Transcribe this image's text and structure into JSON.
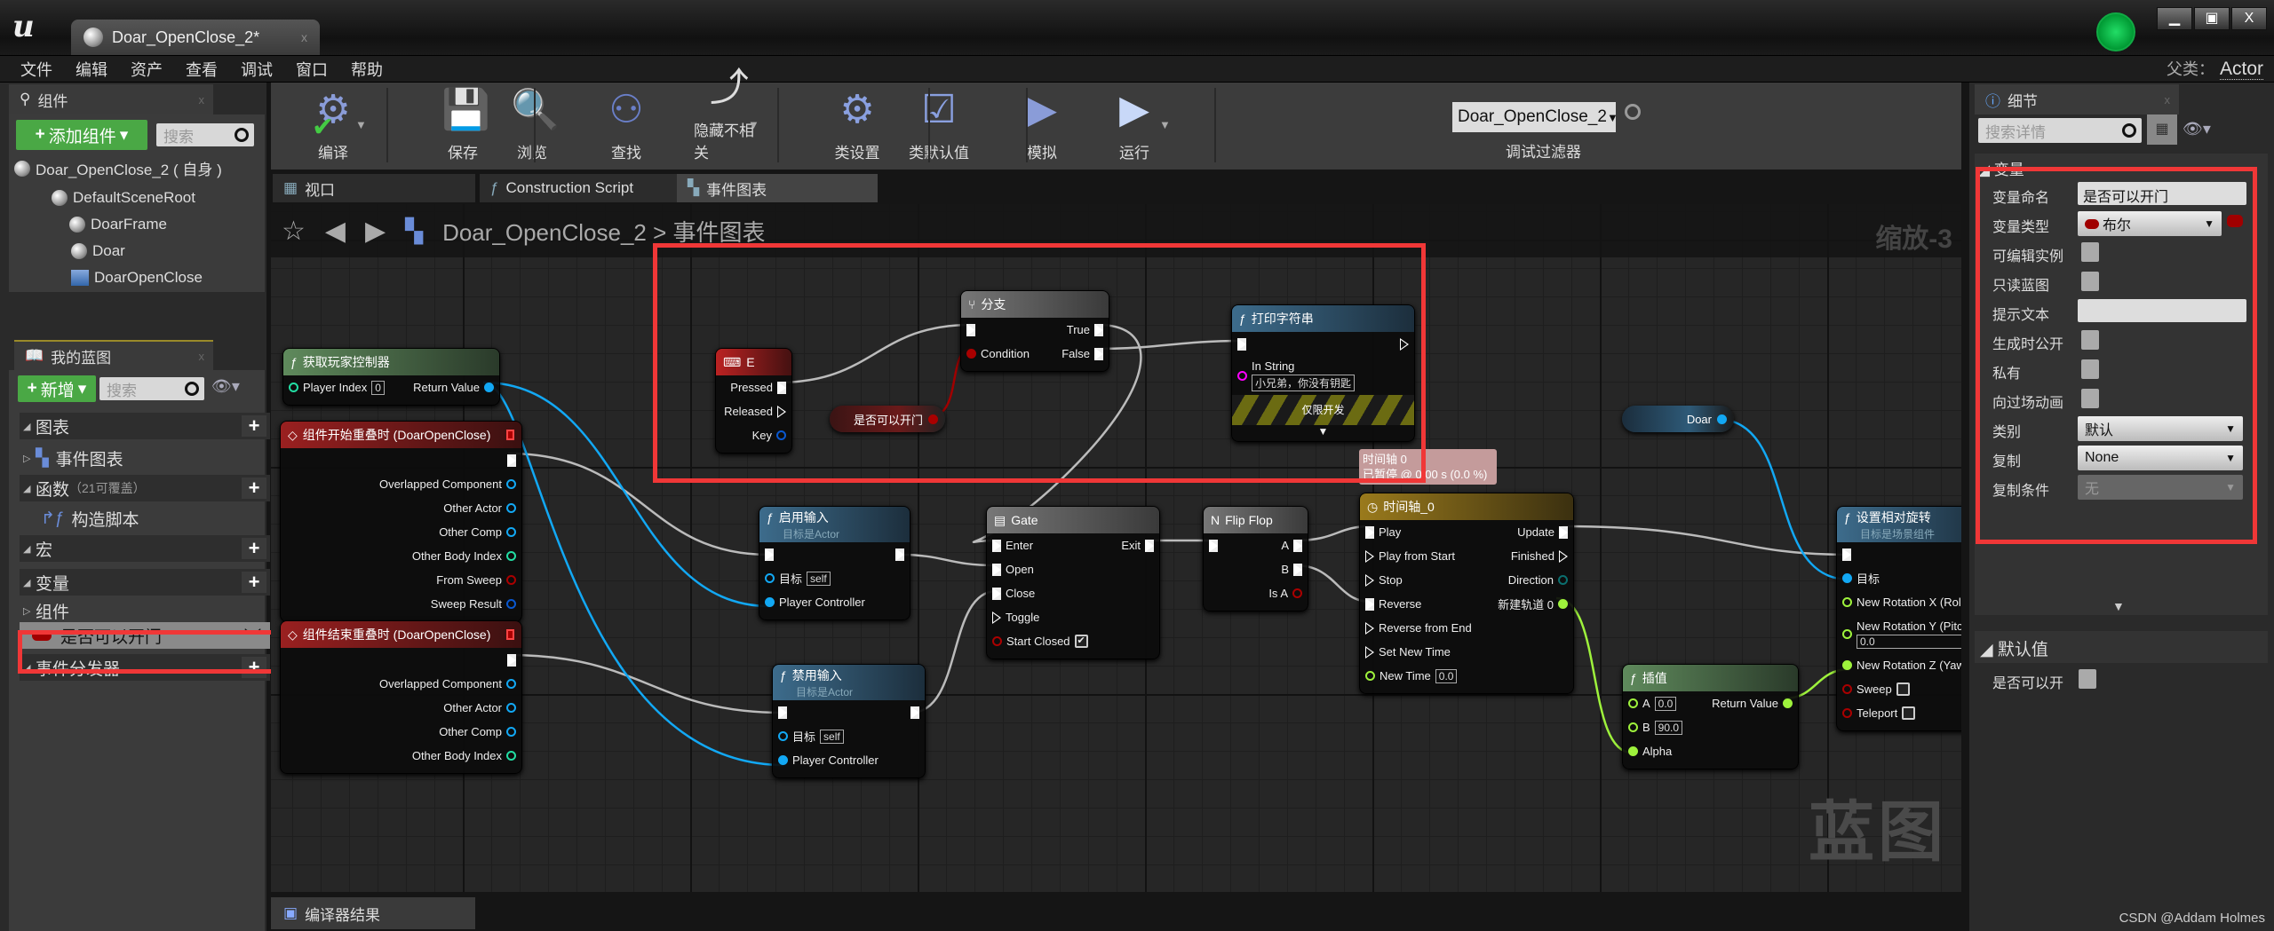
{
  "window": {
    "tab_title": "Doar_OpenClose_2*",
    "tab_close": "x",
    "controls": [
      "▁",
      "▣",
      "X"
    ]
  },
  "menu": [
    "文件",
    "编辑",
    "资产",
    "查看",
    "调试",
    "窗口",
    "帮助"
  ],
  "parent_class": {
    "label": "父类：",
    "value": "Actor"
  },
  "components": {
    "tab": "组件",
    "add_button": "添加组件",
    "search_placeholder": "搜索",
    "tree": [
      {
        "label": "Doar_OpenClose_2 ( 自身 )",
        "icon": "sphere-icon"
      },
      {
        "label": "DefaultSceneRoot",
        "icon": "scene-root-icon"
      },
      {
        "label": "DoarFrame",
        "icon": "static-mesh-icon"
      },
      {
        "label": "Doar",
        "icon": "static-mesh-icon"
      },
      {
        "label": "DoarOpenClose",
        "icon": "box-collision-icon"
      }
    ]
  },
  "my_blueprint": {
    "tab": "我的蓝图",
    "new_button": "新增",
    "search_placeholder": "搜索",
    "rows": [
      {
        "label": "图表",
        "kind": "cat",
        "plus": true
      },
      {
        "label": "事件图表",
        "kind": "item"
      },
      {
        "label": "函数",
        "extra": "（21可覆盖）",
        "kind": "cat",
        "plus": true
      },
      {
        "label": "构造脚本",
        "kind": "item"
      },
      {
        "label": "宏",
        "kind": "cat",
        "plus": true
      },
      {
        "label": "变量",
        "kind": "cat",
        "plus": true
      },
      {
        "label": "组件",
        "kind": "item"
      },
      {
        "label": "是否可以开门",
        "kind": "selected"
      },
      {
        "label": "事件分发器",
        "kind": "cat",
        "plus": true
      }
    ]
  },
  "toolbar": {
    "buttons": [
      {
        "label": "编译",
        "icon": "compile-icon"
      },
      {
        "label": "保存",
        "icon": "save-icon"
      },
      {
        "label": "浏览",
        "icon": "browse-icon"
      },
      {
        "label": "查找",
        "icon": "find-icon"
      },
      {
        "label": "隐藏不相关",
        "icon": "hide-unrelated-icon"
      },
      {
        "label": "类设置",
        "icon": "class-settings-icon"
      },
      {
        "label": "类默认值",
        "icon": "class-defaults-icon"
      },
      {
        "label": "模拟",
        "icon": "simulate-icon"
      },
      {
        "label": "运行",
        "icon": "play-icon"
      }
    ],
    "debug_filter": {
      "value": "Doar_OpenClose_2",
      "label": "调试过滤器"
    }
  },
  "graph_tabs": [
    {
      "label": "视口",
      "icon": "viewport-icon"
    },
    {
      "label": "Construction Script",
      "icon": "function-icon"
    },
    {
      "label": "事件图表",
      "icon": "event-graph-icon",
      "active": true
    }
  ],
  "graph": {
    "breadcrumb_root": "Doar_OpenClose_2",
    "breadcrumb_sep": ">",
    "breadcrumb_current": "事件图表",
    "zoom": "缩放-3",
    "watermark": "蓝图"
  },
  "nodes": [
    {
      "id": "get-player-controller",
      "kind": "pure",
      "icon": "ƒ",
      "title": "获取玩家控制器",
      "rows": [
        {
          "l": {
            "t": "int",
            "label": "Player Index",
            "value": "0"
          },
          "r": {
            "t": "object",
            "label": "Return Value",
            "c": true
          }
        }
      ]
    },
    {
      "id": "begin-overlap",
      "kind": "event",
      "icon": "◇",
      "title": "组件开始重叠时 (DoarOpenClose)",
      "delegate": true,
      "rows": [
        {
          "r": {
            "t": "exec",
            "c": true
          }
        },
        {
          "r": {
            "t": "object",
            "label": "Overlapped Component"
          }
        },
        {
          "r": {
            "t": "object",
            "label": "Other Actor"
          }
        },
        {
          "r": {
            "t": "object",
            "label": "Other Comp"
          }
        },
        {
          "r": {
            "t": "int",
            "label": "Other Body Index"
          }
        },
        {
          "r": {
            "t": "bool",
            "label": "From Sweep"
          }
        },
        {
          "r": {
            "t": "struct",
            "label": "Sweep Result"
          }
        }
      ]
    },
    {
      "id": "end-overlap",
      "kind": "event",
      "icon": "◇",
      "title": "组件结束重叠时 (DoarOpenClose)",
      "delegate": true,
      "rows": [
        {
          "r": {
            "t": "exec",
            "c": true
          }
        },
        {
          "r": {
            "t": "object",
            "label": "Overlapped Component"
          }
        },
        {
          "r": {
            "t": "object",
            "label": "Other Actor"
          }
        },
        {
          "r": {
            "t": "object",
            "label": "Other Comp"
          }
        },
        {
          "r": {
            "t": "int",
            "label": "Other Body Index"
          }
        }
      ]
    },
    {
      "id": "key-e",
      "kind": "input",
      "icon": "⌨",
      "title": "E",
      "rows": [
        {
          "r": {
            "t": "exec",
            "label": "Pressed",
            "c": true
          }
        },
        {
          "r": {
            "t": "exec",
            "label": "Released"
          }
        },
        {
          "r": {
            "t": "struct",
            "label": "Key"
          }
        }
      ]
    },
    {
      "id": "branch",
      "kind": "macro",
      "icon": "⑂",
      "title": "分支",
      "rows": [
        {
          "l": {
            "t": "exec",
            "c": true
          },
          "r": {
            "t": "exec",
            "label": "True",
            "c": true
          }
        },
        {
          "l": {
            "t": "bool",
            "label": "Condition",
            "c": true
          },
          "r": {
            "t": "exec",
            "label": "False",
            "c": true
          }
        }
      ]
    },
    {
      "id": "print-string",
      "kind": "func",
      "icon": "ƒ",
      "title": "打印字符串",
      "dev_only": "仅限开发",
      "rows": [
        {
          "l": {
            "t": "exec",
            "c": true
          },
          "r": {
            "t": "exec"
          }
        },
        {
          "l": {
            "t": "string",
            "label": "In String",
            "value": "小兄弟，你没有钥匙",
            "stack": true
          }
        }
      ]
    },
    {
      "id": "enable-input",
      "kind": "func",
      "icon": "ƒ",
      "title": "启用输入",
      "subtitle": "目标是Actor",
      "rows": [
        {
          "l": {
            "t": "exec",
            "c": true
          },
          "r": {
            "t": "exec",
            "c": true
          }
        },
        {
          "l": {
            "t": "object",
            "label": "目标",
            "value": "self"
          }
        },
        {
          "l": {
            "t": "object",
            "label": "Player Controller",
            "c": true
          }
        }
      ]
    },
    {
      "id": "disable-input",
      "kind": "func",
      "icon": "ƒ",
      "title": "禁用输入",
      "subtitle": "目标是Actor",
      "rows": [
        {
          "l": {
            "t": "exec",
            "c": true
          },
          "r": {
            "t": "exec",
            "c": true
          }
        },
        {
          "l": {
            "t": "object",
            "label": "目标",
            "value": "self"
          }
        },
        {
          "l": {
            "t": "object",
            "label": "Player Controller",
            "c": true
          }
        }
      ]
    },
    {
      "id": "gate",
      "kind": "macro",
      "icon": "▤",
      "title": "Gate",
      "rows": [
        {
          "l": {
            "t": "exec",
            "label": "Enter",
            "c": true
          },
          "r": {
            "t": "exec",
            "label": "Exit",
            "c": true
          }
        },
        {
          "l": {
            "t": "exec",
            "label": "Open",
            "c": true
          }
        },
        {
          "l": {
            "t": "exec",
            "label": "Close",
            "c": true
          }
        },
        {
          "l": {
            "t": "exec",
            "label": "Toggle"
          }
        },
        {
          "l": {
            "t": "bool",
            "label": "Start Closed",
            "check": true
          }
        }
      ]
    },
    {
      "id": "flip-flop",
      "kind": "macro",
      "icon": "N",
      "title": "Flip Flop",
      "rows": [
        {
          "l": {
            "t": "exec",
            "c": true
          },
          "r": {
            "t": "exec",
            "label": "A",
            "c": true
          }
        },
        {
          "r": {
            "t": "exec",
            "label": "B",
            "c": true
          }
        },
        {
          "r": {
            "t": "bool",
            "label": "Is A"
          }
        }
      ]
    },
    {
      "id": "timeline",
      "kind": "timeline",
      "icon": "◷",
      "title": "时间轴_0",
      "rows": [
        {
          "l": {
            "t": "exec",
            "label": "Play",
            "c": true
          },
          "r": {
            "t": "exec",
            "label": "Update",
            "c": true
          }
        },
        {
          "l": {
            "t": "exec",
            "label": "Play from Start"
          },
          "r": {
            "t": "exec",
            "label": "Finished"
          }
        },
        {
          "l": {
            "t": "exec",
            "label": "Stop"
          },
          "r": {
            "t": "enum",
            "label": "Direction"
          }
        },
        {
          "l": {
            "t": "exec",
            "label": "Reverse",
            "c": true
          },
          "r": {
            "t": "float",
            "label": "新建轨道 0",
            "c": true
          }
        },
        {
          "l": {
            "t": "exec",
            "label": "Reverse from End"
          }
        },
        {
          "l": {
            "t": "exec",
            "label": "Set New Time"
          }
        },
        {
          "l": {
            "t": "float",
            "label": "New Time",
            "value": "0.0"
          }
        }
      ]
    },
    {
      "id": "lerp",
      "kind": "pure",
      "icon": "ƒ",
      "title": "插值",
      "rows": [
        {
          "l": {
            "t": "float",
            "label": "A",
            "value": "0.0"
          },
          "r": {
            "t": "float",
            "label": "Return Value",
            "c": true
          }
        },
        {
          "l": {
            "t": "float",
            "label": "B",
            "value": "90.0"
          }
        },
        {
          "l": {
            "t": "float",
            "label": "Alpha",
            "c": true
          }
        }
      ]
    },
    {
      "id": "set-relative-rotation",
      "kind": "func",
      "icon": "ƒ",
      "title": "设置相对旋转",
      "subtitle": "目标是场景组件",
      "rows": [
        {
          "l": {
            "t": "exec",
            "c": true
          }
        },
        {
          "l": {
            "t": "object",
            "label": "目标",
            "c": true
          }
        },
        {
          "l": {
            "t": "float",
            "label": "New Rotation X (Roll)"
          }
        },
        {
          "l": {
            "t": "float",
            "label": "New Rotation Y (Pitch)",
            "value": "0.0",
            "stack": true
          }
        },
        {
          "l": {
            "t": "float",
            "label": "New Rotation Z (Yaw)",
            "c": true
          }
        },
        {
          "l": {
            "t": "bool",
            "label": "Sweep",
            "check": false
          }
        },
        {
          "l": {
            "t": "bool",
            "label": "Teleport",
            "check": false
          }
        }
      ]
    }
  ],
  "var_nodes": [
    {
      "id": "get-can-open",
      "label": "是否可以开门",
      "type": "bool"
    },
    {
      "id": "get-doar",
      "label": "Doar",
      "type": "object"
    }
  ],
  "timeline_comment": {
    "line1": "时间轴 0",
    "line2": "已暂停 @ 0.00 s (0.0 %)"
  },
  "details": {
    "tab": "细节",
    "search_placeholder": "搜索详情",
    "section": "变量",
    "rows": [
      {
        "label": "变量命名",
        "kind": "text",
        "value": "是否可以开门"
      },
      {
        "label": "变量类型",
        "kind": "type",
        "value": "布尔"
      },
      {
        "label": "可编辑实例",
        "kind": "check"
      },
      {
        "label": "只读蓝图",
        "kind": "check"
      },
      {
        "label": "提示文本",
        "kind": "text",
        "value": ""
      },
      {
        "label": "生成时公开",
        "kind": "check"
      },
      {
        "label": "私有",
        "kind": "check"
      },
      {
        "label": "向过场动画",
        "kind": "check"
      },
      {
        "label": "类别",
        "kind": "select",
        "value": "默认"
      },
      {
        "label": "复制",
        "kind": "select",
        "value": "None"
      },
      {
        "label": "复制条件",
        "kind": "select",
        "value": "无",
        "disabled": true
      }
    ],
    "defaults_section": "默认值",
    "defaults_row": "是否可以开"
  },
  "bottom_tab": "编译器结果",
  "credit": "CSDN @Addam Holmes",
  "colors": {
    "highlight": "#f03737",
    "bool_pin": "#a00000",
    "object_pin": "#12a8f4",
    "float_pin": "#9ef23c",
    "add_button": "#4aa845"
  }
}
